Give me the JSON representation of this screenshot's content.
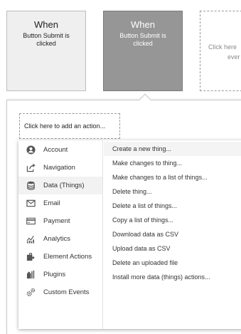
{
  "events": [
    {
      "title": "When",
      "subtitle_line1": "Button Submit is",
      "subtitle_line2": "clicked"
    },
    {
      "title": "When",
      "subtitle_line1": "Button Submit is",
      "subtitle_line2": "clicked"
    }
  ],
  "partial_card": {
    "line1": "Click here",
    "line2": "ever"
  },
  "add_action_label": "Click here to add an action...",
  "categories": [
    {
      "label": "Account",
      "icon": "account-icon"
    },
    {
      "label": "Navigation",
      "icon": "navigation-icon"
    },
    {
      "label": "Data (Things)",
      "icon": "database-icon",
      "selected": true
    },
    {
      "label": "Email",
      "icon": "email-icon"
    },
    {
      "label": "Payment",
      "icon": "payment-icon"
    },
    {
      "label": "Analytics",
      "icon": "analytics-icon"
    },
    {
      "label": "Element Actions",
      "icon": "element-actions-icon"
    },
    {
      "label": "Plugins",
      "icon": "plugins-icon"
    },
    {
      "label": "Custom Events",
      "icon": "custom-events-icon"
    }
  ],
  "actions": [
    {
      "label": "Create a new thing..."
    },
    {
      "label": "Make changes to thing..."
    },
    {
      "label": "Make changes to a list of things..."
    },
    {
      "label": "Delete thing..."
    },
    {
      "label": "Delete a list of things..."
    },
    {
      "label": "Copy a list of things..."
    },
    {
      "label": "Download data as CSV"
    },
    {
      "label": "Upload data as CSV"
    },
    {
      "label": "Delete an uploaded file"
    },
    {
      "label": "Install more data (things) actions..."
    }
  ]
}
